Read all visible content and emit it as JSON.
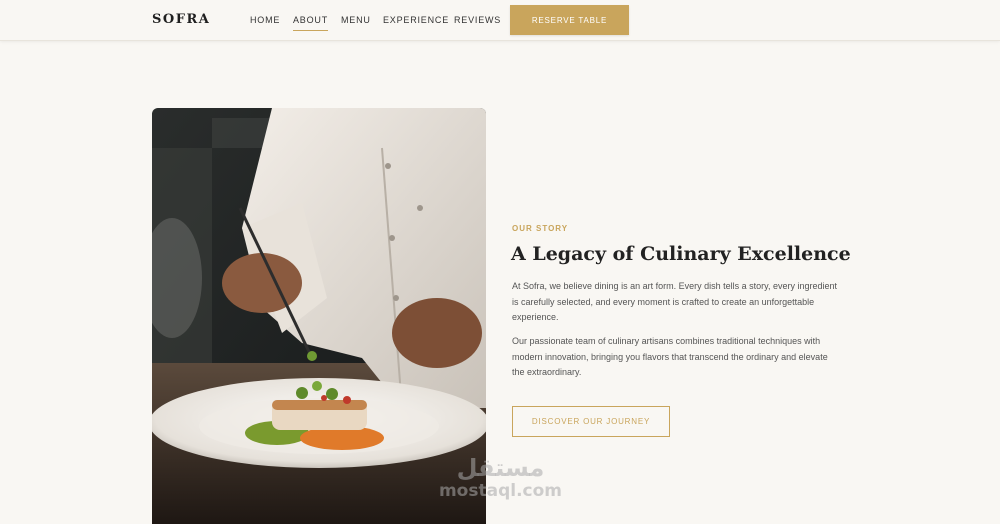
{
  "header": {
    "logo": "SOFRA",
    "nav": [
      {
        "label": "HOME",
        "active": false
      },
      {
        "label": "ABOUT",
        "active": true
      },
      {
        "label": "MENU",
        "active": false
      },
      {
        "label": "EXPERIENCE",
        "active": false
      },
      {
        "label": "REVIEWS",
        "active": false
      }
    ],
    "cta_label": "RESERVE TABLE"
  },
  "about": {
    "image_alt": "chef-plating-dish-photo",
    "eyebrow": "OUR STORY",
    "title": "A Legacy of Culinary Excellence",
    "paragraph_1": "At Sofra, we believe dining is an art form. Every dish tells a story, every ingredient is carefully selected, and every moment is crafted to create an unforgettable experience.",
    "paragraph_2": "Our passionate team of culinary artisans combines traditional techniques with modern innovation, bringing you flavors that transcend the ordinary and elevate the extraordinary.",
    "button_label": "DISCOVER OUR JOURNEY"
  },
  "watermark": {
    "arabic": "مستقل",
    "latin": "mostaql.com"
  },
  "colors": {
    "accent": "#c9a55c",
    "background": "#f9f7f3",
    "heading": "#222222",
    "body_text": "#555555"
  }
}
